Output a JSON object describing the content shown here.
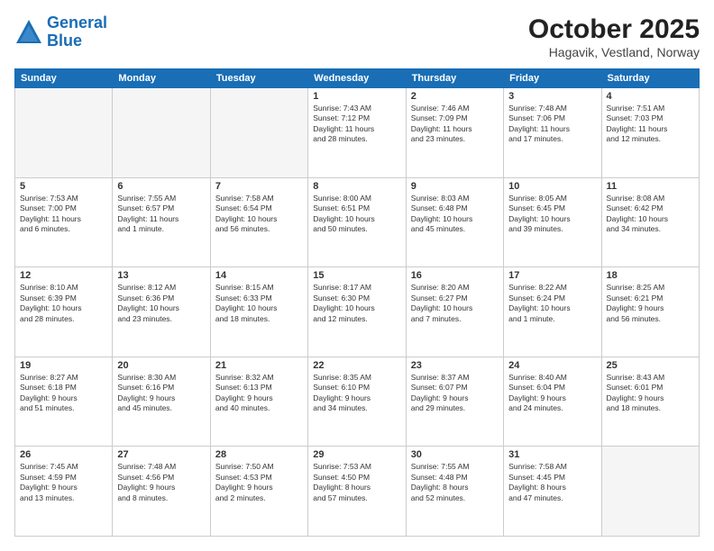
{
  "header": {
    "logo_line1": "General",
    "logo_line2": "Blue",
    "month": "October 2025",
    "location": "Hagavik, Vestland, Norway"
  },
  "weekdays": [
    "Sunday",
    "Monday",
    "Tuesday",
    "Wednesday",
    "Thursday",
    "Friday",
    "Saturday"
  ],
  "weeks": [
    [
      {
        "day": "",
        "info": ""
      },
      {
        "day": "",
        "info": ""
      },
      {
        "day": "",
        "info": ""
      },
      {
        "day": "1",
        "info": "Sunrise: 7:43 AM\nSunset: 7:12 PM\nDaylight: 11 hours\nand 28 minutes."
      },
      {
        "day": "2",
        "info": "Sunrise: 7:46 AM\nSunset: 7:09 PM\nDaylight: 11 hours\nand 23 minutes."
      },
      {
        "day": "3",
        "info": "Sunrise: 7:48 AM\nSunset: 7:06 PM\nDaylight: 11 hours\nand 17 minutes."
      },
      {
        "day": "4",
        "info": "Sunrise: 7:51 AM\nSunset: 7:03 PM\nDaylight: 11 hours\nand 12 minutes."
      }
    ],
    [
      {
        "day": "5",
        "info": "Sunrise: 7:53 AM\nSunset: 7:00 PM\nDaylight: 11 hours\nand 6 minutes."
      },
      {
        "day": "6",
        "info": "Sunrise: 7:55 AM\nSunset: 6:57 PM\nDaylight: 11 hours\nand 1 minute."
      },
      {
        "day": "7",
        "info": "Sunrise: 7:58 AM\nSunset: 6:54 PM\nDaylight: 10 hours\nand 56 minutes."
      },
      {
        "day": "8",
        "info": "Sunrise: 8:00 AM\nSunset: 6:51 PM\nDaylight: 10 hours\nand 50 minutes."
      },
      {
        "day": "9",
        "info": "Sunrise: 8:03 AM\nSunset: 6:48 PM\nDaylight: 10 hours\nand 45 minutes."
      },
      {
        "day": "10",
        "info": "Sunrise: 8:05 AM\nSunset: 6:45 PM\nDaylight: 10 hours\nand 39 minutes."
      },
      {
        "day": "11",
        "info": "Sunrise: 8:08 AM\nSunset: 6:42 PM\nDaylight: 10 hours\nand 34 minutes."
      }
    ],
    [
      {
        "day": "12",
        "info": "Sunrise: 8:10 AM\nSunset: 6:39 PM\nDaylight: 10 hours\nand 28 minutes."
      },
      {
        "day": "13",
        "info": "Sunrise: 8:12 AM\nSunset: 6:36 PM\nDaylight: 10 hours\nand 23 minutes."
      },
      {
        "day": "14",
        "info": "Sunrise: 8:15 AM\nSunset: 6:33 PM\nDaylight: 10 hours\nand 18 minutes."
      },
      {
        "day": "15",
        "info": "Sunrise: 8:17 AM\nSunset: 6:30 PM\nDaylight: 10 hours\nand 12 minutes."
      },
      {
        "day": "16",
        "info": "Sunrise: 8:20 AM\nSunset: 6:27 PM\nDaylight: 10 hours\nand 7 minutes."
      },
      {
        "day": "17",
        "info": "Sunrise: 8:22 AM\nSunset: 6:24 PM\nDaylight: 10 hours\nand 1 minute."
      },
      {
        "day": "18",
        "info": "Sunrise: 8:25 AM\nSunset: 6:21 PM\nDaylight: 9 hours\nand 56 minutes."
      }
    ],
    [
      {
        "day": "19",
        "info": "Sunrise: 8:27 AM\nSunset: 6:18 PM\nDaylight: 9 hours\nand 51 minutes."
      },
      {
        "day": "20",
        "info": "Sunrise: 8:30 AM\nSunset: 6:16 PM\nDaylight: 9 hours\nand 45 minutes."
      },
      {
        "day": "21",
        "info": "Sunrise: 8:32 AM\nSunset: 6:13 PM\nDaylight: 9 hours\nand 40 minutes."
      },
      {
        "day": "22",
        "info": "Sunrise: 8:35 AM\nSunset: 6:10 PM\nDaylight: 9 hours\nand 34 minutes."
      },
      {
        "day": "23",
        "info": "Sunrise: 8:37 AM\nSunset: 6:07 PM\nDaylight: 9 hours\nand 29 minutes."
      },
      {
        "day": "24",
        "info": "Sunrise: 8:40 AM\nSunset: 6:04 PM\nDaylight: 9 hours\nand 24 minutes."
      },
      {
        "day": "25",
        "info": "Sunrise: 8:43 AM\nSunset: 6:01 PM\nDaylight: 9 hours\nand 18 minutes."
      }
    ],
    [
      {
        "day": "26",
        "info": "Sunrise: 7:45 AM\nSunset: 4:59 PM\nDaylight: 9 hours\nand 13 minutes."
      },
      {
        "day": "27",
        "info": "Sunrise: 7:48 AM\nSunset: 4:56 PM\nDaylight: 9 hours\nand 8 minutes."
      },
      {
        "day": "28",
        "info": "Sunrise: 7:50 AM\nSunset: 4:53 PM\nDaylight: 9 hours\nand 2 minutes."
      },
      {
        "day": "29",
        "info": "Sunrise: 7:53 AM\nSunset: 4:50 PM\nDaylight: 8 hours\nand 57 minutes."
      },
      {
        "day": "30",
        "info": "Sunrise: 7:55 AM\nSunset: 4:48 PM\nDaylight: 8 hours\nand 52 minutes."
      },
      {
        "day": "31",
        "info": "Sunrise: 7:58 AM\nSunset: 4:45 PM\nDaylight: 8 hours\nand 47 minutes."
      },
      {
        "day": "",
        "info": ""
      }
    ]
  ]
}
